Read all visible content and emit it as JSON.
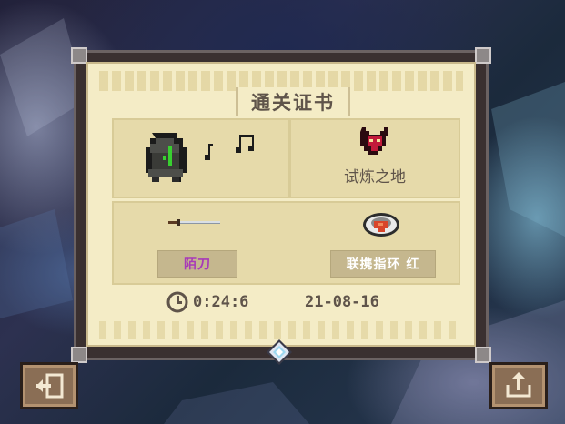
{
  "certificate": {
    "title": "通关证书",
    "region": "试炼之地",
    "weapon": "陌刀",
    "ring": "联携指环 红",
    "time": "0:24:6",
    "date": "21-08-16"
  },
  "colors": {
    "paper": "#f4ecc6",
    "panel": "#e6daaa",
    "text": "#5f544a",
    "weapon_text": "#a83ab8",
    "button": "#8a6e55"
  },
  "icons": [
    "hooded-knight-icon",
    "music-notes-icon",
    "devil-mask-icon",
    "sword-icon",
    "ring-icon",
    "clock-icon",
    "exit-icon",
    "share-icon",
    "gem-icon"
  ]
}
